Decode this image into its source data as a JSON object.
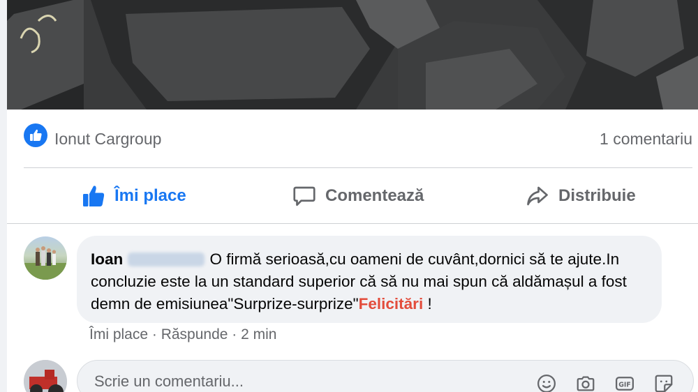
{
  "reactions": {
    "names": "Ionut Cargroup",
    "comment_count": "1 comentariu"
  },
  "actions": {
    "like": "Îmi place",
    "comment": "Comentează",
    "share": "Distribuie"
  },
  "comment": {
    "author_first": "Ioan",
    "text": "O firmă serioasă,cu oameni de cuvânt,dornici să te ajute.In concluzie este la un standard superior că să nu mai spun că aldămașul a fost demn de emisiunea\"Surprize-surprize\"",
    "highlight": "Felicitări",
    "trailing": " !",
    "meta": {
      "like": "Îmi place",
      "reply": "Răspunde",
      "time": "2 min"
    }
  },
  "composer": {
    "placeholder": "Scrie un comentariu..."
  },
  "icons": {
    "reaction": "like-icon",
    "tools": [
      "emoji-icon",
      "camera-icon",
      "gif-icon",
      "sticker-icon"
    ]
  },
  "colors": {
    "accent": "#1877f2",
    "highlight": "#e34c3b"
  }
}
